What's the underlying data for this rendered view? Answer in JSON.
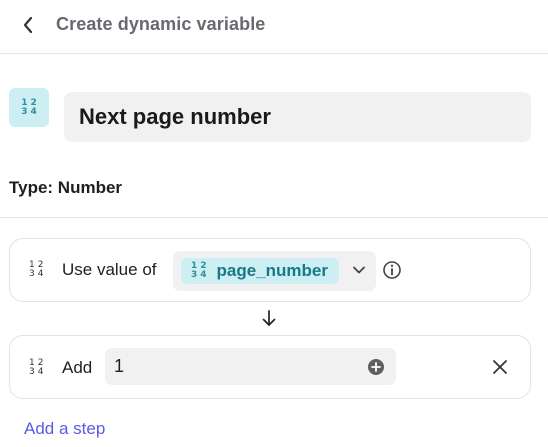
{
  "header": {
    "title": "Create dynamic variable",
    "back_icon": "chevron-left-icon"
  },
  "variable": {
    "icon": "number-type-icon",
    "icon_glyph": [
      "1",
      "2",
      "3",
      "4"
    ],
    "name": "Next page number"
  },
  "type_label": "Type: Number",
  "steps": [
    {
      "label": "Use value of",
      "selected_variable": "page_number",
      "icon": "number-type-icon"
    },
    {
      "label": "Add",
      "value": "1",
      "icon": "number-type-icon"
    }
  ],
  "add_step_label": "Add a step",
  "colors": {
    "accent_teal_bg": "#cdeff3",
    "accent_teal_text": "#177a86",
    "link": "#5a5ae6",
    "field_bg": "#f1f1f1"
  }
}
